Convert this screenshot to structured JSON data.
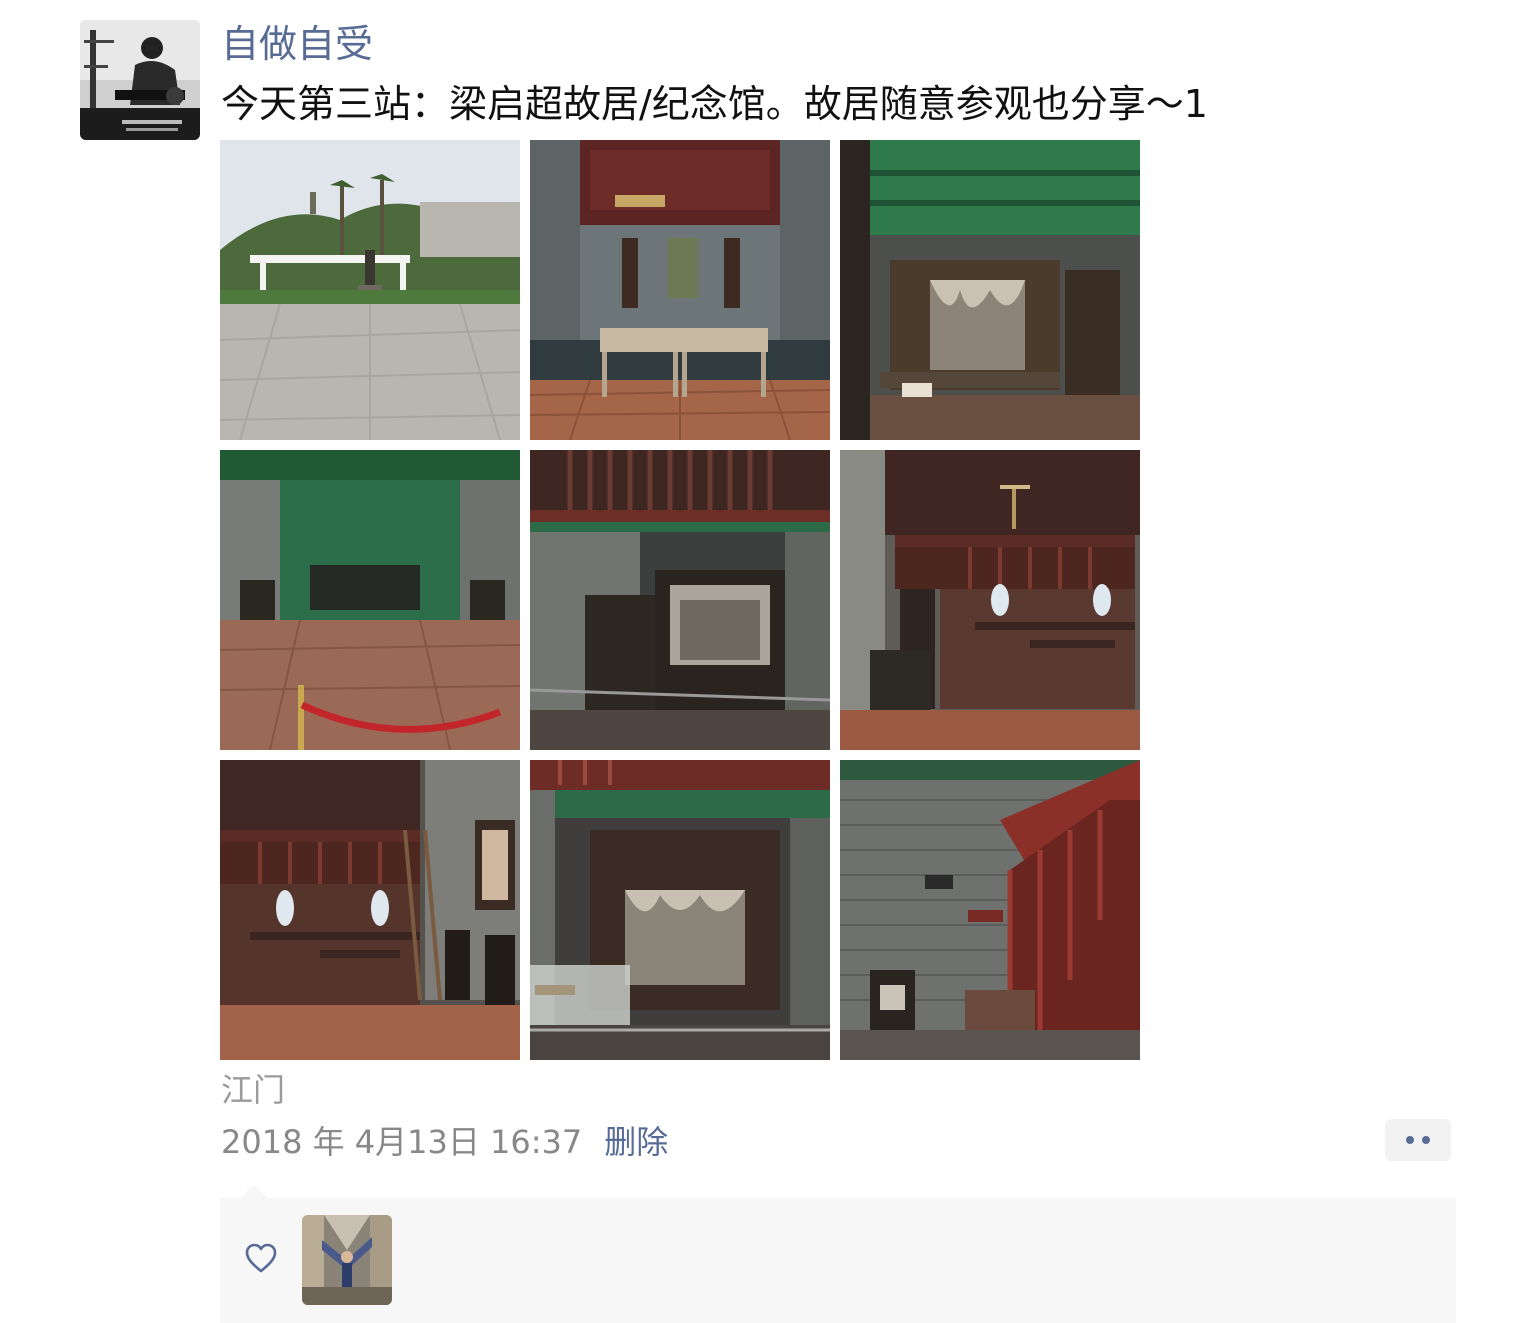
{
  "post": {
    "author_name": "自做自受",
    "text": "今天第三站：梁启超故居/纪念馆。故居随意参观也分享～1",
    "location": "江门",
    "timestamp": "2018 年 4月13日 16:37",
    "delete_label": "删除",
    "photo_count": 9,
    "photos": [
      {
        "subject": "memorial plaza with statue, palm trees and pagoda hill"
      },
      {
        "subject": "study room with two wooden desks and calligraphy"
      },
      {
        "subject": "carved canopy bed under green beams"
      },
      {
        "subject": "green-walled hall with chairs and red rope barrier"
      },
      {
        "subject": "bed chamber with upper gallery railing"
      },
      {
        "subject": "altar with blue-and-white vases and side table"
      },
      {
        "subject": "ancestral shelf with vases, ladder and armchairs"
      },
      {
        "subject": "carved wooden bed with glass display case"
      },
      {
        "subject": "brick room with red wooden staircase and chair"
      }
    ]
  },
  "icons": {
    "more": "more-dots-icon",
    "like": "heart-outline-icon"
  },
  "colors": {
    "link_blue": "#576b95",
    "meta_gray": "#888888",
    "panel_bg": "#f7f7f7"
  }
}
